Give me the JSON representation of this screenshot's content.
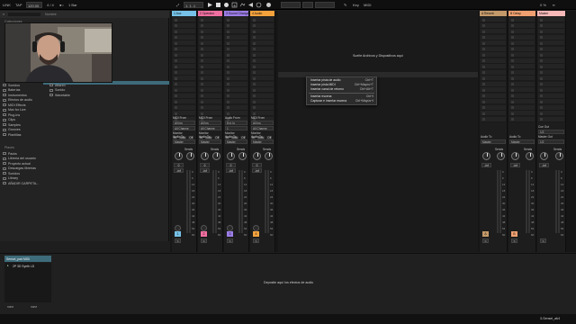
{
  "transport": {
    "tempo": "120.00",
    "meter": "4 / 4",
    "quant": "1 Bar",
    "position": "1.  1.  1",
    "key": "Key",
    "cpu": "0 %"
  },
  "browser": {
    "collections_header": "Colecciones",
    "categories": [
      "Sonidos",
      "Baterías",
      "Instrumentos",
      "Efectos de audio",
      "MIDI Effects",
      "Max for Live",
      "Plug-Ins",
      "Clips",
      "Samples",
      "Grooves",
      "Plantillas"
    ],
    "name_header": "Nombre",
    "files": [
      "Aftaren",
      "Sonido",
      "Wavetable"
    ],
    "places_header": "Places",
    "places": [
      "Packs",
      "Librería del usuario",
      "Proyecto actual",
      "Descargas librerías",
      "Sonidos",
      "Library",
      "AÑADIR CARPETA..."
    ]
  },
  "tracks": [
    {
      "name": "1 Aux",
      "color": "#76c2e8",
      "num": "1",
      "io_from": "MIDI From",
      "io_from_val": "All Ins",
      "io_ch": "All Channe",
      "monitor": "Monitor",
      "mon_opts": [
        "In",
        "Auto",
        "Off"
      ],
      "out_label": "Audio To",
      "out_val": "Master",
      "sends": "Sends",
      "pan_l": "-inf",
      "pan_r": "-inf",
      "vol": "0"
    },
    {
      "name": "2 Operator",
      "color": "#f06fa0",
      "num": "2",
      "io_from": "MIDI From",
      "io_from_val": "All Ins",
      "io_ch": "All Channe",
      "monitor": "Monitor",
      "mon_opts": [
        "In",
        "Auto",
        "Off"
      ],
      "out_label": "Audio To",
      "out_val": "Master",
      "sends": "Sends",
      "pan_l": "-inf",
      "pan_r": "-inf",
      "vol": "0"
    },
    {
      "name": "3 Sound Changer",
      "color": "#9c7de8",
      "num": "3",
      "io_from": "Audio From",
      "io_from_val": "Ext. In",
      "io_ch": "1",
      "monitor": "Monitor",
      "mon_opts": [
        "In",
        "Auto",
        "Off"
      ],
      "out_label": "Audio To",
      "out_val": "Master",
      "sends": "Sends",
      "pan_l": "-inf",
      "pan_r": "-inf",
      "vol": "0"
    },
    {
      "name": "4 Audio",
      "color": "#f4a23c",
      "num": "4",
      "io_from": "MIDI From",
      "io_from_val": "All Ins",
      "io_ch": "All Channe",
      "monitor": "Monitor",
      "mon_opts": [
        "In",
        "Auto",
        "Off"
      ],
      "out_label": "Audio To",
      "out_val": "Master",
      "sends": "Sends",
      "pan_l": "-inf",
      "pan_r": "-inf",
      "vol": "0"
    }
  ],
  "drop_hint": "Suelte Archivos y Dispositivos aquí",
  "context_menu": [
    {
      "label": "Insertar pista de audio",
      "key": "Ctrl+T"
    },
    {
      "label": "Insertar pista MIDI",
      "key": "Ctrl+Mayús+T"
    },
    {
      "label": "Insertar canal de retorno",
      "key": "Ctrl+Alt+T"
    },
    {
      "label": "Insertar escena",
      "key": "Ctrl+I"
    },
    {
      "label": "Capturar e insertar escena",
      "key": "Ctrl+Mayús+I"
    }
  ],
  "returns": [
    {
      "name": "A Reverb",
      "color": "#c49a6a",
      "letter": "A",
      "out_label": "Audio To",
      "out_val": "Master",
      "sends": "Sends",
      "vol": "-inf"
    },
    {
      "name": "B Delay",
      "color": "#f0a070",
      "letter": "B",
      "out_label": "Audio To",
      "out_val": "Master",
      "sends": "Sends",
      "vol": "-inf"
    }
  ],
  "master": {
    "name": "Master",
    "color": "#f7b8b8",
    "cue_label": "Cue Out",
    "cue_val": "1/2",
    "out_label": "Master Out",
    "out_val": "1/2",
    "sends": "Sends",
    "vol": "-inf"
  },
  "scale": [
    "0",
    "6",
    "12",
    "18",
    "24",
    "30",
    "36",
    "42",
    "48",
    "54",
    "60"
  ],
  "detail": {
    "device_chain_title": "Sensei_pad MIDI",
    "device": "2P 3D Synth LD",
    "drop_effects": "Deposite aquí los efectos de audio",
    "left_none": "none",
    "right_none": "none"
  },
  "status": {
    "track_label": "3-Sensei_ab4"
  }
}
